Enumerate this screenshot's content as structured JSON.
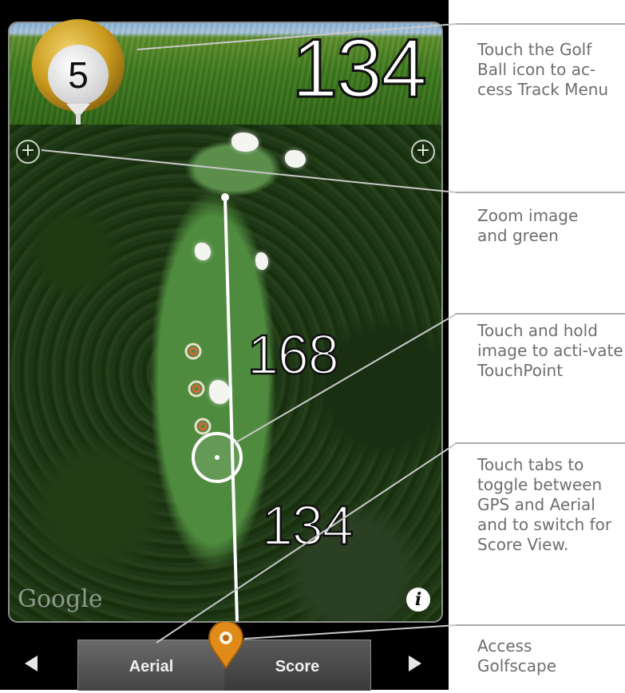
{
  "track": {
    "hole_number": "5",
    "header_distance": "134",
    "map_distances": [
      "168",
      "134"
    ],
    "map_attribution": "Google",
    "info_icon": "i"
  },
  "tabs": {
    "aerial_label": "Aerial",
    "score_label": "Score"
  },
  "icons": {
    "golf_ball": "golf-ball-icon",
    "zoom_left": "plus-circle-icon",
    "zoom_right": "plus-circle-icon",
    "pin": "map-pin-icon",
    "prev": "triangle-left-icon",
    "next": "triangle-right-icon"
  },
  "callouts": [
    "Touch the Golf Ball icon to ac-cess Track Menu",
    "Zoom image and green",
    "Touch and hold image to acti-vate TouchPoint",
    "Touch tabs to toggle between GPS and Aerial and to switch for Score View.",
    "Access Golfscape"
  ],
  "colors": {
    "ball_gold": "#c99a1e",
    "pin_orange": "#e08a1a",
    "target_rings": "#d06a3a",
    "callout_text": "#6e6e6e"
  }
}
